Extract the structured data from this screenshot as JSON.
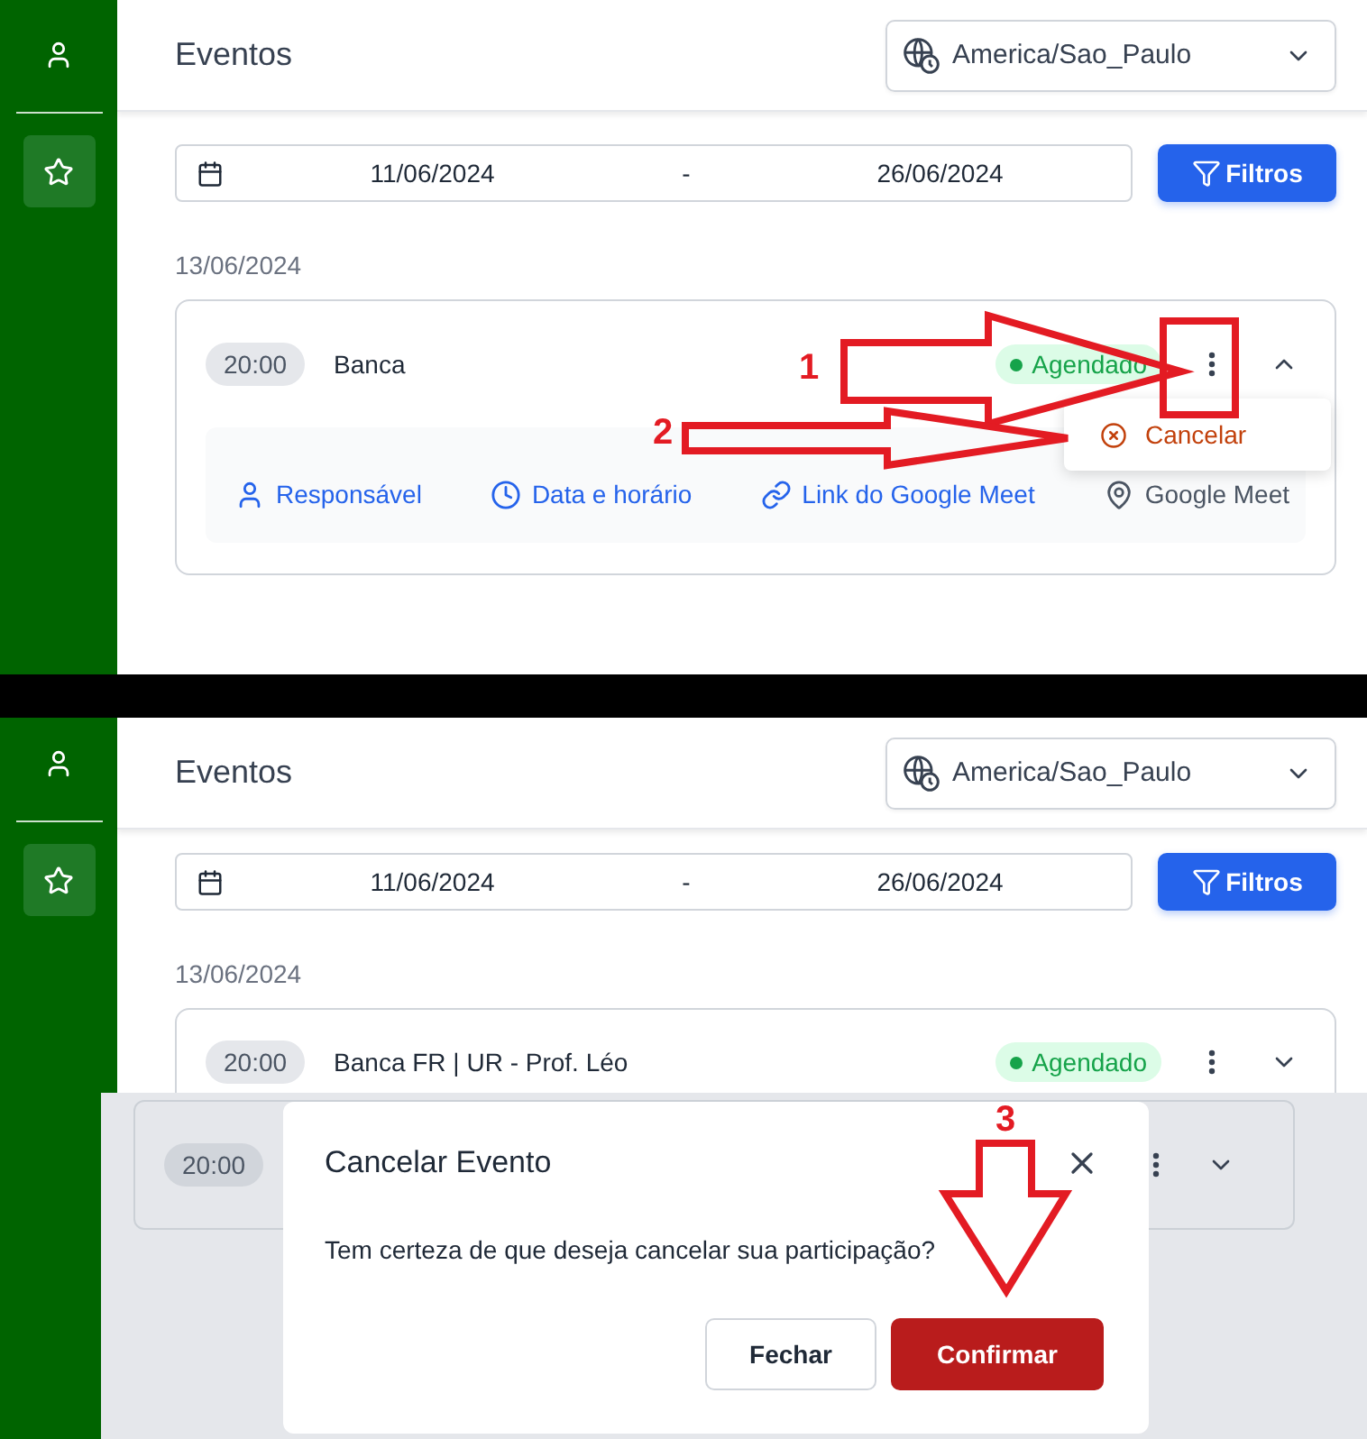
{
  "screens": [
    {
      "sidebar": {
        "items": [
          {
            "selected": false
          },
          {
            "selected": true
          }
        ]
      },
      "header": {
        "title": "Eventos",
        "timezone": "America/Sao_Paulo"
      },
      "filters": {
        "date_from": "11/06/2024",
        "separator": "-",
        "date_to": "26/06/2024",
        "button": "Filtros"
      },
      "date_heading": "13/06/2024",
      "event": {
        "time": "20:00",
        "title": "Banca",
        "status": "Agendado",
        "expanded": true,
        "details": [
          {
            "label": "Responsável",
            "kind": "link"
          },
          {
            "label": "Data e horário",
            "kind": "link"
          },
          {
            "label": "Link do Google Meet",
            "kind": "link"
          },
          {
            "label": "Google Meet",
            "kind": "plain"
          }
        ]
      },
      "menu": {
        "items": [
          {
            "label": "Cancelar"
          }
        ]
      },
      "annotations": [
        {
          "label": "1"
        },
        {
          "label": "2"
        }
      ]
    },
    {
      "sidebar": {
        "items": [
          {
            "selected": false
          },
          {
            "selected": true
          }
        ]
      },
      "header": {
        "title": "Eventos",
        "timezone": "America/Sao_Paulo"
      },
      "filters": {
        "date_from": "11/06/2024",
        "separator": "-",
        "date_to": "26/06/2024",
        "button": "Filtros"
      },
      "date_heading": "13/06/2024",
      "event": {
        "time": "20:00",
        "title": "Banca FR | UR - Prof. Léo",
        "status": "Agendado",
        "expanded": false
      },
      "dialog": {
        "backdrop_event": {
          "time": "20:00",
          "expanded": false
        },
        "title": "Cancelar Evento",
        "message": "Tem certeza de que deseja cancelar sua participação?",
        "buttons": [
          {
            "label": "Fechar",
            "kind": "secondary"
          },
          {
            "label": "Confirmar",
            "kind": "primary"
          }
        ]
      },
      "annotations": [
        {
          "label": "3"
        }
      ]
    }
  ]
}
